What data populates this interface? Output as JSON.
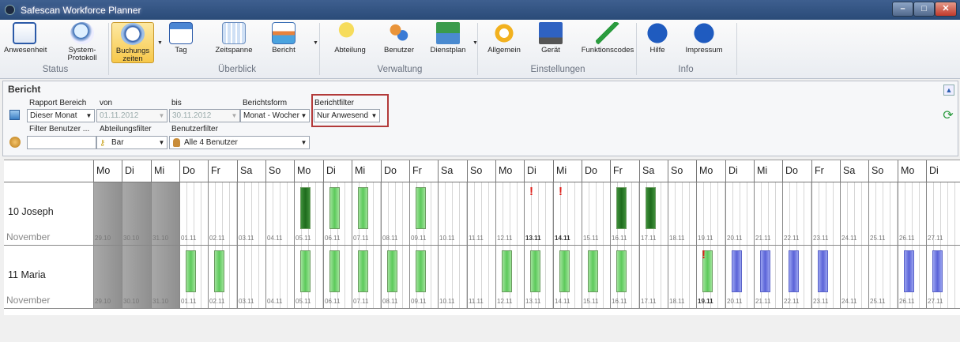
{
  "window": {
    "title": "Safescan Workforce Planner"
  },
  "ribbon": {
    "buttons": [
      {
        "name": "anwesenheit",
        "label": "Anwesenheit",
        "icon": "list-icon"
      },
      {
        "name": "system-protokoll",
        "label": "System-\nProtokoll",
        "icon": "magnifier-icon"
      },
      {
        "name": "buchungszeiten",
        "label": "Buchungs\nzeiten",
        "icon": "clock-icon"
      },
      {
        "name": "tag",
        "label": "Tag",
        "icon": "calendar-day-icon"
      },
      {
        "name": "zeitspanne",
        "label": "Zeitspanne",
        "icon": "calendar-range-icon"
      },
      {
        "name": "bericht",
        "label": "Bericht",
        "icon": "report-icon"
      },
      {
        "name": "abteilung",
        "label": "Abteilung",
        "icon": "key-icon"
      },
      {
        "name": "benutzer",
        "label": "Benutzer",
        "icon": "users-icon"
      },
      {
        "name": "dienstplan",
        "label": "Dienstplan",
        "icon": "roster-icon"
      },
      {
        "name": "allgemein",
        "label": "Allgemein",
        "icon": "gear-icon"
      },
      {
        "name": "geraet",
        "label": "Gerät",
        "icon": "monitor-icon"
      },
      {
        "name": "funktionscodes",
        "label": "Funktionscodes",
        "icon": "arrows-icon"
      },
      {
        "name": "hilfe",
        "label": "Hilfe",
        "icon": "help-icon"
      },
      {
        "name": "impressum",
        "label": "Impressum",
        "icon": "info-icon"
      }
    ],
    "groups": [
      "Status",
      "Überblick",
      "Verwaltung",
      "Einstellungen",
      "Info"
    ]
  },
  "report": {
    "title": "Bericht",
    "rapport_label": "Rapport Bereich",
    "rapport_value": "Dieser Monat",
    "von_label": "von",
    "von_value": "01.11.2012",
    "bis_label": "bis",
    "bis_value": "30.11.2012",
    "form_label": "Berichtsform",
    "form_value": "Monat - Wocher",
    "filter_label": "Berichtfilter",
    "filter_value": "Nur Anwesend",
    "user_filter_label": "Filter Benutzer ...",
    "user_filter_value": "",
    "dept_label": "Abteilungsfilter",
    "dept_value": "Bar",
    "users_label": "Benutzerfilter",
    "users_value": "Alle 4 Benutzer"
  },
  "calendar": {
    "days": [
      "Mo",
      "Di",
      "Mi",
      "Do",
      "Fr",
      "Sa",
      "So",
      "Mo",
      "Di",
      "Mi",
      "Do",
      "Fr",
      "Sa",
      "So",
      "Mo",
      "Di",
      "Mi",
      "Do",
      "Fr",
      "Sa",
      "So",
      "Mo",
      "Di",
      "Mi",
      "Do",
      "Fr",
      "Sa",
      "So",
      "Mo",
      "Di"
    ],
    "dates": [
      "29.10",
      "30.10",
      "31.10",
      "01.11",
      "02.11",
      "03.11",
      "04.11",
      "05.11",
      "06.11",
      "07.11",
      "08.11",
      "09.11",
      "10.11",
      "11.11",
      "12.11",
      "13.11",
      "14.11",
      "15.11",
      "16.11",
      "17.11",
      "18.11",
      "19.11",
      "20.11",
      "21.11",
      "22.11",
      "23.11",
      "24.11",
      "25.11",
      "26.11",
      "27.11"
    ],
    "employees": [
      {
        "name": "10 Joseph",
        "month": "November",
        "bars": [
          {
            "day": 7,
            "color": "green"
          },
          {
            "day": 8,
            "color": "light"
          },
          {
            "day": 9,
            "color": "light"
          },
          {
            "day": 11,
            "color": "light"
          },
          {
            "day": 18,
            "color": "green"
          },
          {
            "day": 19,
            "color": "green"
          }
        ],
        "alerts": [
          15,
          16
        ]
      },
      {
        "name": "11 Maria",
        "month": "November",
        "bars": [
          {
            "day": 3,
            "color": "light"
          },
          {
            "day": 4,
            "color": "light"
          },
          {
            "day": 7,
            "color": "light"
          },
          {
            "day": 8,
            "color": "light"
          },
          {
            "day": 9,
            "color": "light"
          },
          {
            "day": 10,
            "color": "light"
          },
          {
            "day": 11,
            "color": "light"
          },
          {
            "day": 14,
            "color": "light"
          },
          {
            "day": 15,
            "color": "light"
          },
          {
            "day": 16,
            "color": "light"
          },
          {
            "day": 17,
            "color": "light"
          },
          {
            "day": 18,
            "color": "light"
          },
          {
            "day": 21,
            "color": "light"
          },
          {
            "day": 22,
            "color": "blue"
          },
          {
            "day": 23,
            "color": "blue"
          },
          {
            "day": 24,
            "color": "blue"
          },
          {
            "day": 25,
            "color": "blue"
          },
          {
            "day": 28,
            "color": "blue"
          },
          {
            "day": 29,
            "color": "blue"
          }
        ],
        "alerts": [
          21
        ]
      }
    ]
  }
}
